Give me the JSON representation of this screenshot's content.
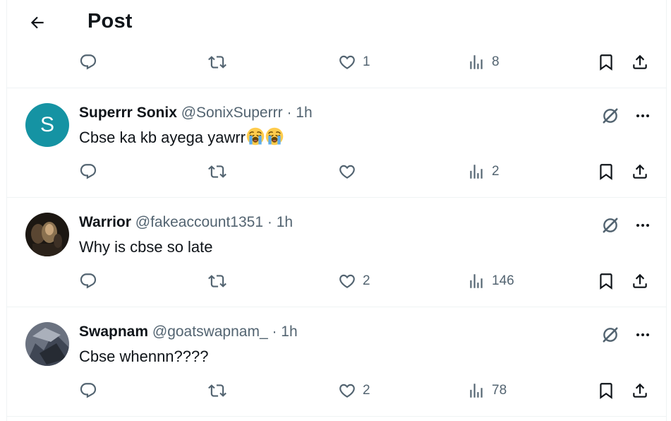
{
  "header": {
    "title": "Post",
    "back_icon": "arrow-left-icon"
  },
  "top_actions": {
    "likes": "1",
    "views": "8"
  },
  "posts": [
    {
      "display_name": "Superrr Sonix",
      "handle": "@SonixSuperrr",
      "time": "· 1h",
      "text": "Cbse ka kb ayega yawrr",
      "emoji": [
        "loudly-crying-face",
        "loudly-crying-face"
      ],
      "avatar_letter": "S",
      "likes": "",
      "views": "2"
    },
    {
      "display_name": "Warrior",
      "handle": "@fakeaccount1351",
      "time": "· 1h",
      "text": "Why is cbse so late",
      "likes": "2",
      "views": "146"
    },
    {
      "display_name": "Swapnam",
      "handle": "@goatswapnam_",
      "time": "· 1h",
      "text": "Cbse whennn????",
      "likes": "2",
      "views": "78"
    }
  ],
  "colors": {
    "muted": "#536471",
    "text": "#0f1419",
    "avatar_bg": "#1593a3",
    "divider": "#eff3f4"
  }
}
